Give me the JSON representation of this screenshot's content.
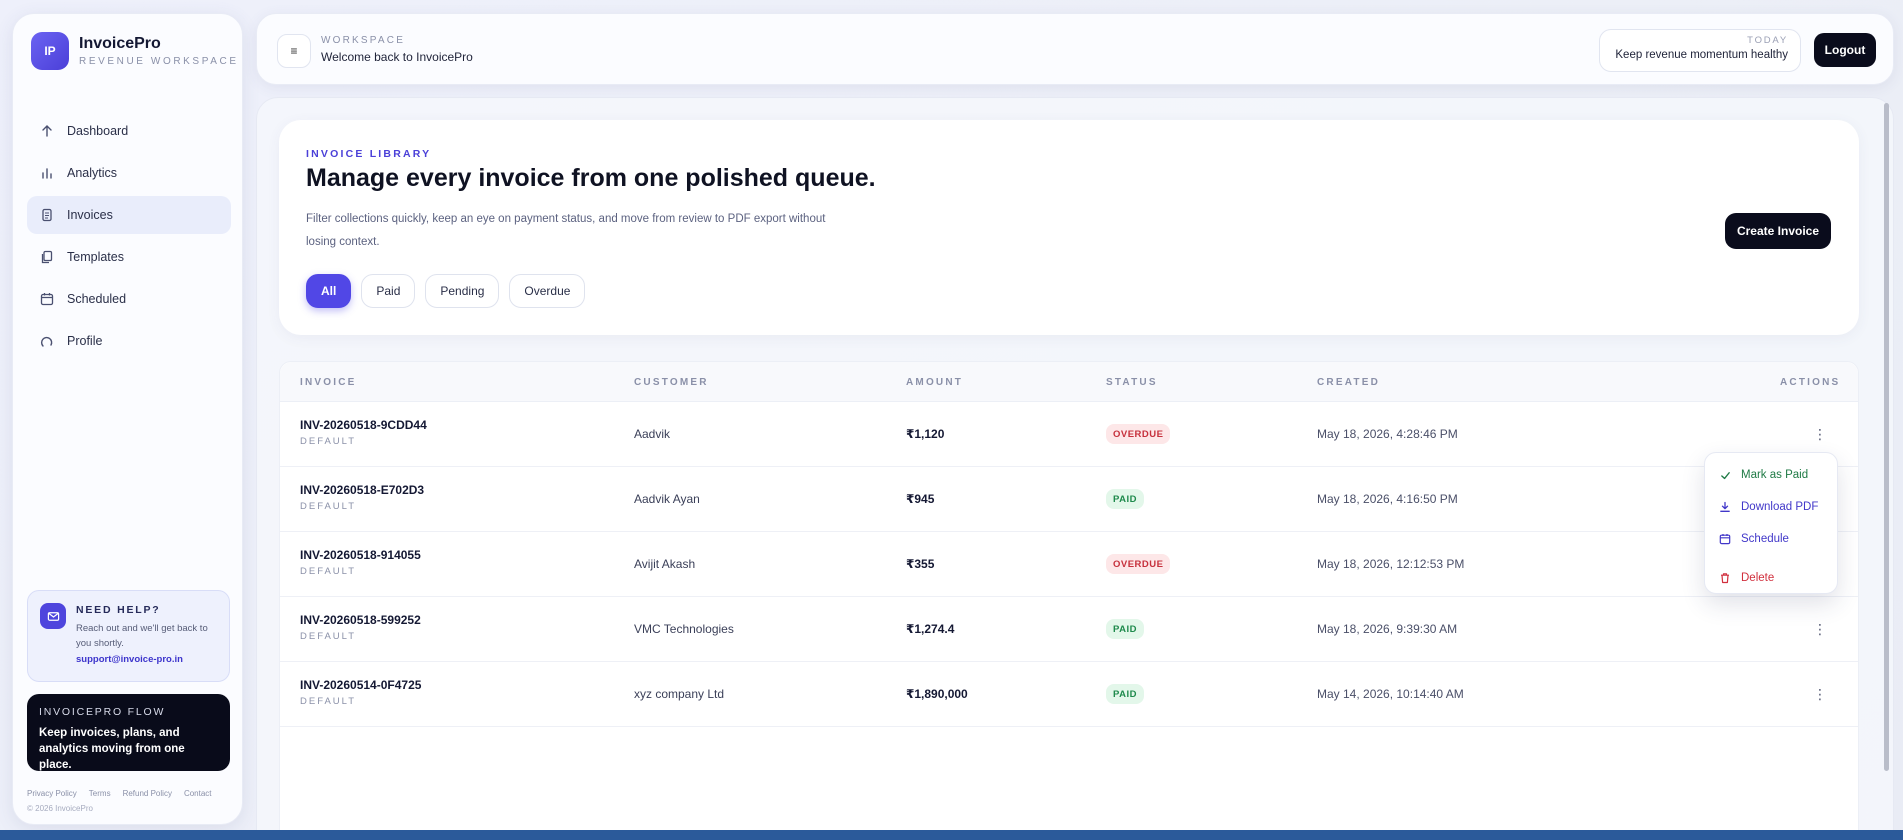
{
  "brand": {
    "logo": "IP",
    "name": "InvoicePro",
    "subtitle": "REVENUE WORKSPACE"
  },
  "nav": {
    "items": [
      {
        "label": "Dashboard",
        "icon": "dashboard-icon"
      },
      {
        "label": "Analytics",
        "icon": "analytics-icon"
      },
      {
        "label": "Invoices",
        "icon": "invoice-icon",
        "active": true
      },
      {
        "label": "Templates",
        "icon": "templates-icon"
      },
      {
        "label": "Scheduled",
        "icon": "calendar-icon"
      },
      {
        "label": "Profile",
        "icon": "profile-icon"
      }
    ]
  },
  "help": {
    "title": "NEED HELP?",
    "text": "Reach out and we'll get back to you shortly.",
    "email": "support@invoice-pro.in"
  },
  "flow": {
    "title": "INVOICEPRO FLOW",
    "text": "Keep invoices, plans, and analytics moving from one place."
  },
  "footer": {
    "links": [
      "Privacy Policy",
      "Terms",
      "Refund Policy",
      "Contact"
    ],
    "copyright": "© 2026 InvoicePro"
  },
  "header": {
    "menu_glyph": "≡",
    "workspace_label": "WORKSPACE",
    "welcome": "Welcome back to InvoicePro",
    "today_label": "TODAY",
    "today_text": "Keep revenue momentum healthy",
    "logout": "Logout"
  },
  "hero": {
    "eyebrow": "INVOICE LIBRARY",
    "title": "Manage every invoice from one polished queue.",
    "description": "Filter collections quickly, keep an eye on payment status, and move from review to PDF export without losing context.",
    "filters": [
      "All",
      "Paid",
      "Pending",
      "Overdue"
    ],
    "active_filter": "All",
    "create_button": "Create Invoice"
  },
  "table": {
    "columns": [
      "INVOICE",
      "CUSTOMER",
      "AMOUNT",
      "STATUS",
      "CREATED",
      "ACTIONS"
    ],
    "rows": [
      {
        "id": "INV-20260518-9CDD44",
        "template": "DEFAULT",
        "customer": "Aadvik",
        "amount": "₹1,120",
        "status": "OVERDUE",
        "created": "May 18, 2026, 4:28:46 PM"
      },
      {
        "id": "INV-20260518-E702D3",
        "template": "DEFAULT",
        "customer": "Aadvik Ayan",
        "amount": "₹945",
        "status": "PAID",
        "created": "May 18, 2026, 4:16:50 PM"
      },
      {
        "id": "INV-20260518-914055",
        "template": "DEFAULT",
        "customer": "Avijit Akash",
        "amount": "₹355",
        "status": "OVERDUE",
        "created": "May 18, 2026, 12:12:53 PM"
      },
      {
        "id": "INV-20260518-599252",
        "template": "DEFAULT",
        "customer": "VMC Technologies",
        "amount": "₹1,274.4",
        "status": "PAID",
        "created": "May 18, 2026, 9:39:30 AM"
      },
      {
        "id": "INV-20260514-0F4725",
        "template": "DEFAULT",
        "customer": "xyz company Ltd",
        "amount": "₹1,890,000",
        "status": "PAID",
        "created": "May 14, 2026, 10:14:40 AM"
      }
    ],
    "kebab_glyph": "⋮"
  },
  "actions_menu": {
    "items": [
      {
        "label": "Mark as Paid",
        "icon": "check-icon"
      },
      {
        "label": "Download PDF",
        "icon": "download-icon"
      },
      {
        "label": "Schedule",
        "icon": "calendar-icon"
      },
      {
        "label": "Delete",
        "icon": "trash-icon"
      }
    ]
  },
  "colors": {
    "accent": "#5147e6",
    "dark": "#0a0c1c",
    "overdue": "#c6303c",
    "paid": "#1f8a4c"
  }
}
